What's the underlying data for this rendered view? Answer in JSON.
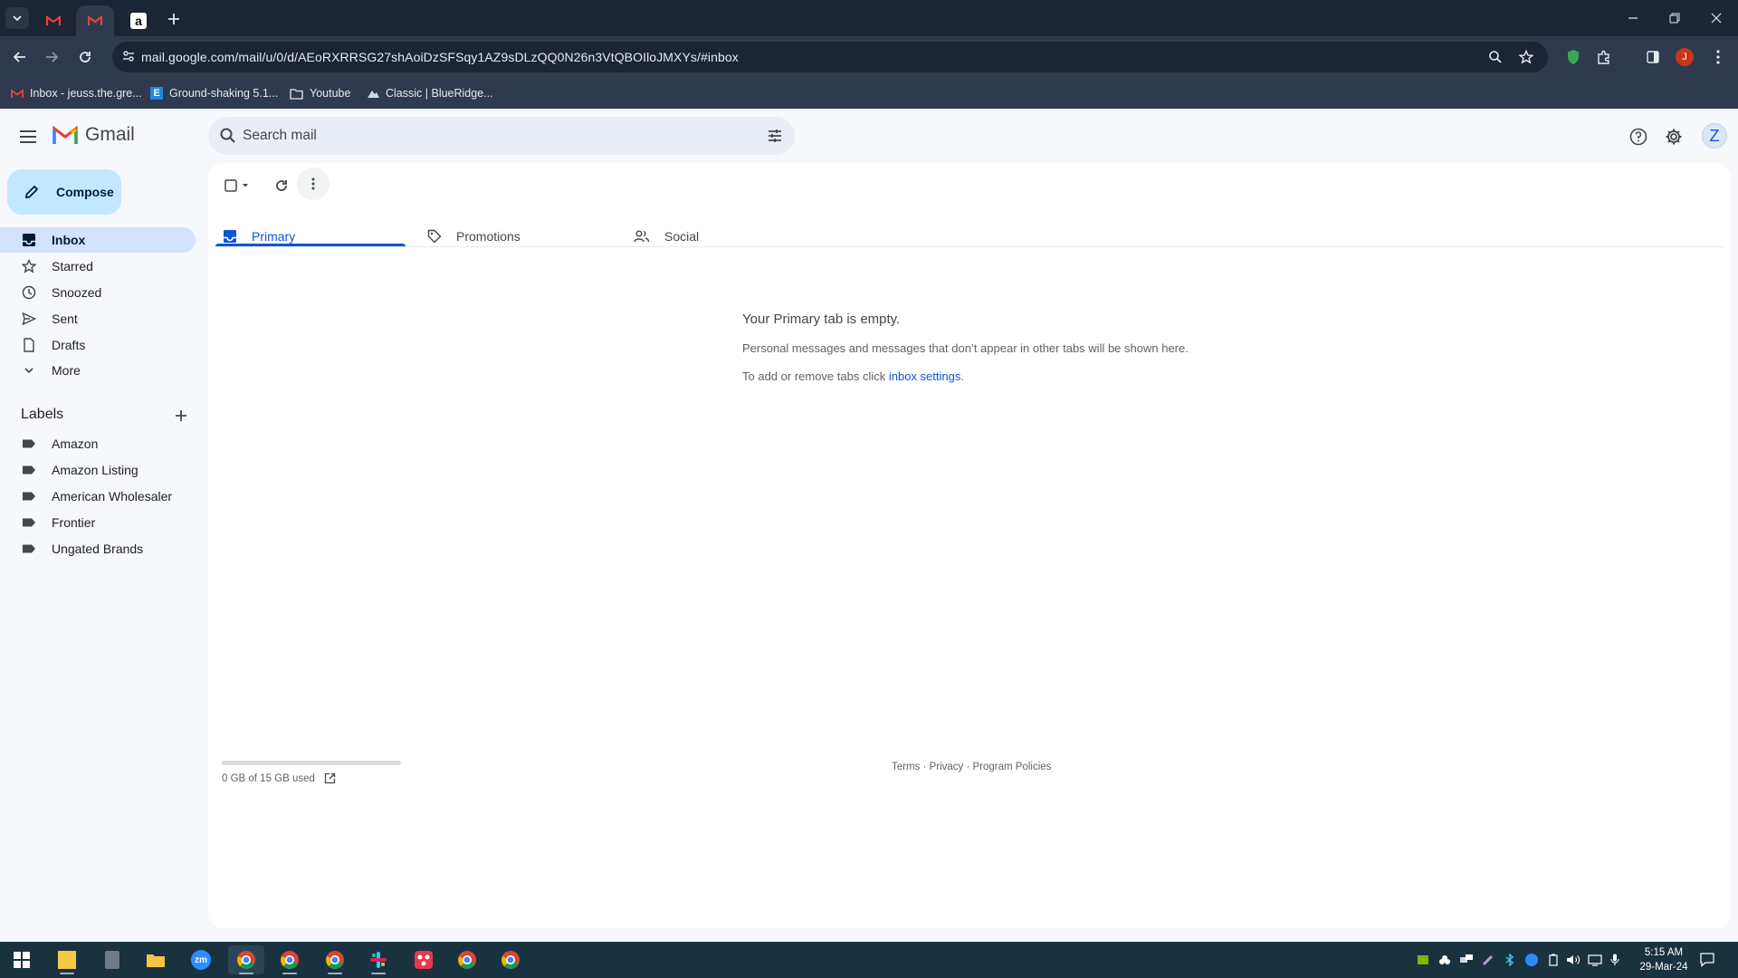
{
  "browser": {
    "url": "mail.google.com/mail/u/0/d/AEoRXRRSG27shAoiDzSFSqy1AZ9sDLzQQ0N26n3VtQBOIloJMXYs/#inbox",
    "profile_initial": "J",
    "bookmarks": [
      {
        "label": "Inbox - jeuss.the.gre...",
        "icon": "gmail-icon"
      },
      {
        "label": "Ground-shaking 5.1...",
        "icon": "e-site-icon"
      },
      {
        "label": "Youtube",
        "icon": "folder-icon"
      },
      {
        "label": "Classic | BlueRidge...",
        "icon": "mountain-icon"
      }
    ]
  },
  "gmail": {
    "product_name": "Gmail",
    "search_placeholder": "Search mail",
    "account_initial": "Z",
    "compose_label": "Compose",
    "nav": [
      {
        "label": "Inbox",
        "icon": "inbox-icon",
        "active": true
      },
      {
        "label": "Starred",
        "icon": "star-icon"
      },
      {
        "label": "Snoozed",
        "icon": "clock-icon"
      },
      {
        "label": "Sent",
        "icon": "send-icon"
      },
      {
        "label": "Drafts",
        "icon": "draft-icon"
      },
      {
        "label": "More",
        "icon": "chevron-down-icon"
      }
    ],
    "labels_heading": "Labels",
    "labels": [
      "Amazon",
      "Amazon Listing",
      "American Wholesaler",
      "Frontier",
      "Ungated Brands"
    ],
    "tabs": [
      {
        "label": "Primary",
        "icon": "inbox-tab-icon",
        "active": true
      },
      {
        "label": "Promotions",
        "icon": "tag-icon"
      },
      {
        "label": "Social",
        "icon": "people-icon"
      }
    ],
    "empty_state": {
      "title": "Your Primary tab is empty.",
      "line1": "Personal messages and messages that don’t appear in other tabs will be shown here.",
      "line2_prefix": "To add or remove tabs click ",
      "line2_link": "inbox settings",
      "line2_suffix": "."
    },
    "storage": {
      "text": "0 GB of 15 GB used",
      "fraction_used": 0.0
    },
    "footer": {
      "terms": "Terms",
      "privacy": "Privacy",
      "policies": "Program Policies",
      "separator": "·"
    }
  },
  "taskbar": {
    "time": "5:15 AM",
    "date": "29-Mar-24"
  },
  "colors": {
    "accent": "#0b57d0",
    "compose_bg": "#c2e7ff",
    "active_nav_bg": "#d3e3fd",
    "chrome_dark": "#1c2535",
    "taskbar": "#19323f"
  }
}
